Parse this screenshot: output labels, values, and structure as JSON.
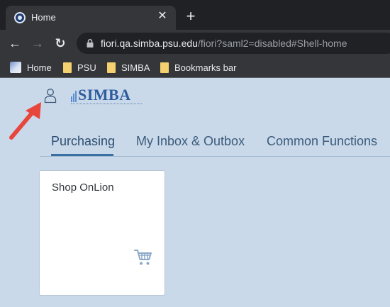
{
  "browser": {
    "tab_title": "Home",
    "close_glyph": "✕",
    "new_tab_glyph": "+",
    "back_glyph": "←",
    "forward_glyph": "→",
    "reload_glyph": "↻",
    "url_host": "fiori.qa.simba.psu.edu",
    "url_rest": "/fiori?saml2=disabled#Shell-home"
  },
  "bookmarks": [
    {
      "label": "Home",
      "icon": "home-icon"
    },
    {
      "label": "PSU",
      "icon": "folder-icon"
    },
    {
      "label": "SIMBA",
      "icon": "folder-icon"
    },
    {
      "label": "Bookmarks bar",
      "icon": "folder-icon"
    }
  ],
  "header": {
    "logo_text": "SIMBA"
  },
  "tabs": [
    {
      "label": "Purchasing",
      "active": true
    },
    {
      "label": "My Inbox & Outbox",
      "active": false
    },
    {
      "label": "Common Functions",
      "active": false
    }
  ],
  "tiles": [
    {
      "title": "Shop OnLion",
      "icon": "cart-icon"
    }
  ],
  "colors": {
    "annotation_arrow": "#e8463c",
    "accent": "#3a6fa3",
    "page_background": "#c9d9e9"
  }
}
